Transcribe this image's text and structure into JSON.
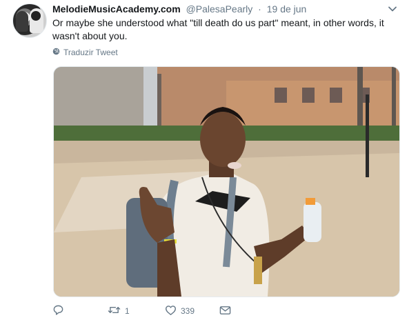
{
  "tweet": {
    "display_name": "MelodieMusicAcademy.com",
    "handle": "@PalesaPearly",
    "separator": "·",
    "date": "19 de jun",
    "text": "Or maybe she understood what \"till death do us part\" meant, in other words, it wasn't about you.",
    "translate_label": "Traduzir Tweet"
  },
  "actions": {
    "reply_count": "",
    "retweet_count": "1",
    "like_count": "339"
  },
  "colors": {
    "text": "#14171a",
    "secondary": "#657786",
    "border": "#e6ecf0"
  },
  "icons": [
    "chevron-down-icon",
    "globe-icon",
    "reply-icon",
    "retweet-icon",
    "heart-icon",
    "envelope-icon"
  ]
}
